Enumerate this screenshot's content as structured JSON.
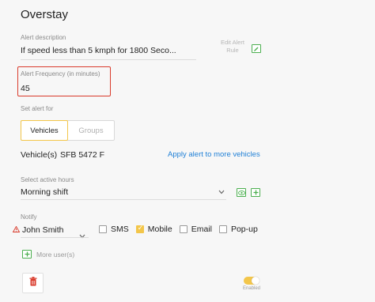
{
  "title": "Overstay",
  "alert_description": {
    "label": "Alert description",
    "value": "If speed less than 5 kmph for 1800 Seco...",
    "edit_rule_line1": "Edit Alert",
    "edit_rule_line2": "Rule"
  },
  "alert_frequency": {
    "label": "Alert Frequency (in minutes)",
    "value": "45"
  },
  "set_alert_for": {
    "label": "Set alert for",
    "tabs": [
      {
        "label": "Vehicles",
        "active": true
      },
      {
        "label": "Groups",
        "active": false
      }
    ]
  },
  "vehicles": {
    "label": "Vehicle(s)",
    "value": "SFB 5472 F",
    "apply_link": "Apply alert to more vehicles"
  },
  "active_hours": {
    "label": "Select active hours",
    "value": "Morning shift"
  },
  "notify": {
    "label": "Notify",
    "user": "John Smith",
    "options": [
      {
        "label": "SMS",
        "checked": false
      },
      {
        "label": "Mobile",
        "checked": true
      },
      {
        "label": "Email",
        "checked": false
      },
      {
        "label": "Pop-up",
        "checked": false
      }
    ],
    "more_users": "More user(s)"
  },
  "footer": {
    "toggle_label": "Enabled",
    "toggle_on": true
  },
  "colors": {
    "accent": "#f3c64a",
    "link": "#1e7fd6",
    "danger": "#d93a2b",
    "success": "#4caf50"
  }
}
